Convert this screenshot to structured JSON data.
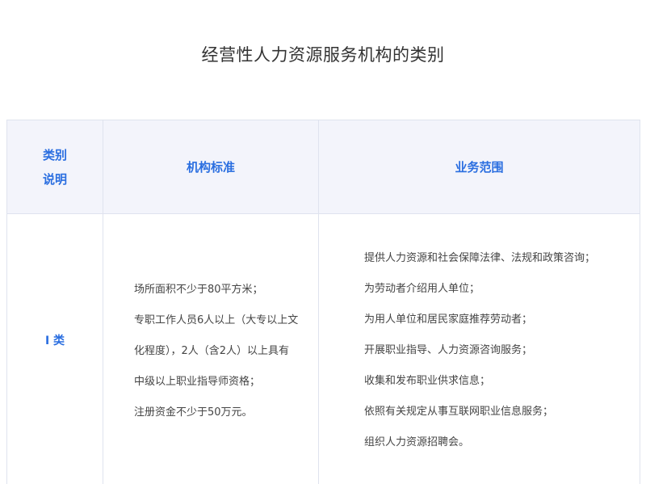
{
  "page": {
    "title": "经营性人力资源服务机构的类别"
  },
  "table": {
    "headers": {
      "category_line1": "类别",
      "category_line2": "说明",
      "standard": "机构标准",
      "scope": "业务范围"
    },
    "rows": [
      {
        "category": "I 类",
        "standard_lines": [
          "场所面积不少于80平方米；",
          "专职工作人员6人以上（大专以上文",
          "化程度），2人（含2人）以上具有",
          "中级以上职业指导师资格；",
          "注册资金不少于50万元。"
        ],
        "scope_lines": [
          "提供人力资源和社会保障法律、法规和政策咨询；",
          "为劳动者介绍用人单位；",
          "为用人单位和居民家庭推荐劳动者；",
          "开展职业指导、人力资源咨询服务；",
          "收集和发布职业供求信息；",
          "依照有关规定从事互联网职业信息服务；",
          "组织人力资源招聘会。"
        ]
      }
    ]
  },
  "colors": {
    "accent": "#2a6ee0",
    "header_bg": "#f3f4fb",
    "border": "#dfe3ee"
  }
}
